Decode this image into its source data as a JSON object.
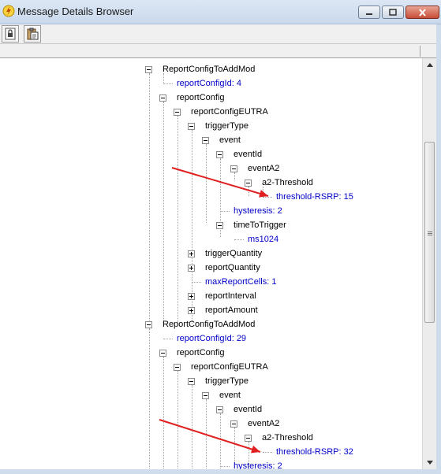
{
  "window": {
    "title": "Message Details Browser"
  },
  "toolbar": {
    "buttons": [
      {
        "icon": "lock-document-icon"
      },
      {
        "icon": "clipboard-paste-icon"
      }
    ]
  },
  "tree": {
    "rows": [
      {
        "text": "ReportConfigToAddMod",
        "kind": "key",
        "toggle": "minus"
      },
      {
        "text": "reportConfigId: 4",
        "kind": "value"
      },
      {
        "text": "reportConfig",
        "kind": "key",
        "toggle": "minus"
      },
      {
        "text": "reportConfigEUTRA",
        "kind": "key",
        "toggle": "minus"
      },
      {
        "text": "triggerType",
        "kind": "key",
        "toggle": "minus"
      },
      {
        "text": "event",
        "kind": "key",
        "toggle": "minus"
      },
      {
        "text": "eventId",
        "kind": "key",
        "toggle": "minus"
      },
      {
        "text": "eventA2",
        "kind": "key",
        "toggle": "minus"
      },
      {
        "text": "a2-Threshold",
        "kind": "key",
        "toggle": "minus"
      },
      {
        "text": "threshold-RSRP: 15",
        "kind": "value"
      },
      {
        "text": "hysteresis: 2",
        "kind": "value"
      },
      {
        "text": "timeToTrigger",
        "kind": "key",
        "toggle": "minus"
      },
      {
        "text": "ms1024",
        "kind": "value"
      },
      {
        "text": "triggerQuantity",
        "kind": "key",
        "toggle": "plus"
      },
      {
        "text": "reportQuantity",
        "kind": "key",
        "toggle": "plus"
      },
      {
        "text": "maxReportCells: 1",
        "kind": "value"
      },
      {
        "text": "reportInterval",
        "kind": "key",
        "toggle": "plus"
      },
      {
        "text": "reportAmount",
        "kind": "key",
        "toggle": "plus"
      },
      {
        "text": "ReportConfigToAddMod",
        "kind": "key",
        "toggle": "minus"
      },
      {
        "text": "reportConfigId: 29",
        "kind": "value"
      },
      {
        "text": "reportConfig",
        "kind": "key",
        "toggle": "minus"
      },
      {
        "text": "reportConfigEUTRA",
        "kind": "key",
        "toggle": "minus"
      },
      {
        "text": "triggerType",
        "kind": "key",
        "toggle": "minus"
      },
      {
        "text": "event",
        "kind": "key",
        "toggle": "minus"
      },
      {
        "text": "eventId",
        "kind": "key",
        "toggle": "minus"
      },
      {
        "text": "eventA2",
        "kind": "key",
        "toggle": "minus"
      },
      {
        "text": "a2-Threshold",
        "kind": "key",
        "toggle": "minus"
      },
      {
        "text": "threshold-RSRP: 32",
        "kind": "value"
      },
      {
        "text": "hysteresis: 2",
        "kind": "value"
      }
    ]
  },
  "annotations": {
    "arrow_color": "#e02020",
    "arrows": [
      {
        "points_to": "threshold-RSRP: 15"
      },
      {
        "points_to": "threshold-RSRP: 32"
      }
    ]
  },
  "colors": {
    "key_text": "#000000",
    "value_text": "#0000c8",
    "title_bar": "#cfdcec"
  }
}
